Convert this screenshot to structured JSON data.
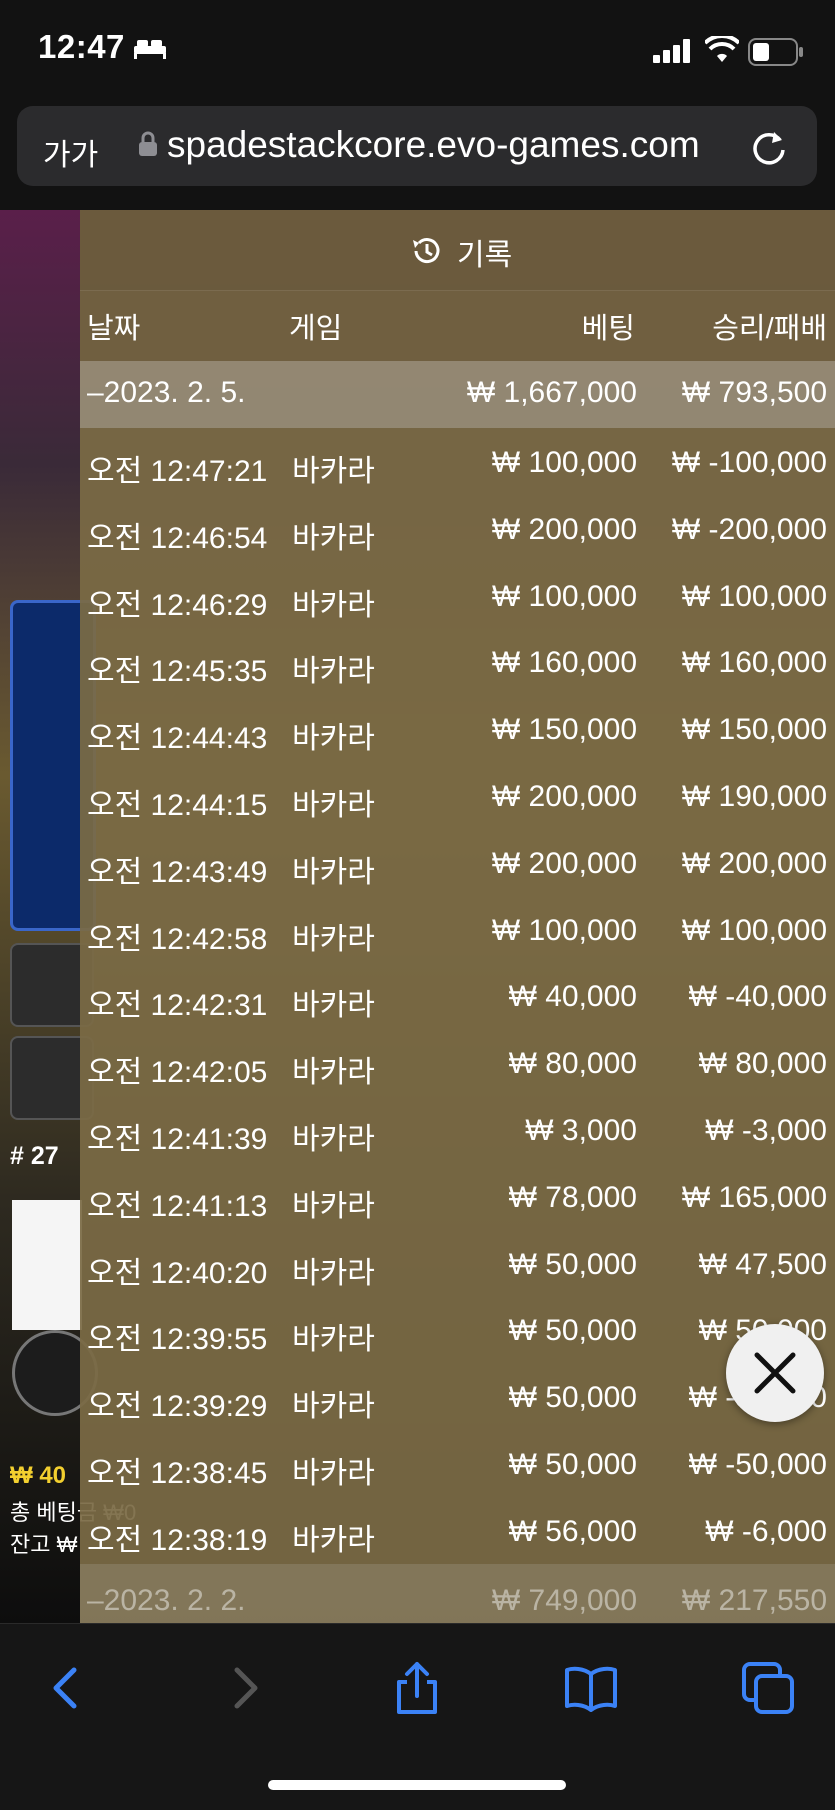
{
  "status_bar": {
    "time": "12:47",
    "icons": [
      "bed-icon",
      "cellular-signal-icon",
      "wifi-icon",
      "battery-icon"
    ]
  },
  "browser": {
    "aa_label": "가가",
    "url": "spadestackcore.evo-games.com",
    "icons": [
      "lock-icon",
      "reload-icon"
    ]
  },
  "game_background": {
    "round_label": "# 27",
    "bet_amount": "₩ 40",
    "total_bet": "총 베팅금 ₩0",
    "balance": "잔고 ₩"
  },
  "history": {
    "title": "기록",
    "columns": {
      "date": "날짜",
      "game": "게임",
      "bet": "베팅",
      "win_loss": "승리/패배"
    },
    "day_group": {
      "date": "–2023. 2. 5.",
      "bet": "₩ 1,667,000",
      "win_loss": "₩ 793,500"
    },
    "rows": [
      {
        "time": "오전 12:47:21",
        "game": "바카라",
        "bet": "₩ 100,000",
        "win_loss": "₩ -100,000"
      },
      {
        "time": "오전 12:46:54",
        "game": "바카라",
        "bet": "₩ 200,000",
        "win_loss": "₩ -200,000"
      },
      {
        "time": "오전 12:46:29",
        "game": "바카라",
        "bet": "₩ 100,000",
        "win_loss": "₩ 100,000"
      },
      {
        "time": "오전 12:45:35",
        "game": "바카라",
        "bet": "₩ 160,000",
        "win_loss": "₩ 160,000"
      },
      {
        "time": "오전 12:44:43",
        "game": "바카라",
        "bet": "₩ 150,000",
        "win_loss": "₩ 150,000"
      },
      {
        "time": "오전 12:44:15",
        "game": "바카라",
        "bet": "₩ 200,000",
        "win_loss": "₩ 190,000"
      },
      {
        "time": "오전 12:43:49",
        "game": "바카라",
        "bet": "₩ 200,000",
        "win_loss": "₩ 200,000"
      },
      {
        "time": "오전 12:42:58",
        "game": "바카라",
        "bet": "₩ 100,000",
        "win_loss": "₩ 100,000"
      },
      {
        "time": "오전 12:42:31",
        "game": "바카라",
        "bet": "₩ 40,000",
        "win_loss": "₩ -40,000"
      },
      {
        "time": "오전 12:42:05",
        "game": "바카라",
        "bet": "₩ 80,000",
        "win_loss": "₩ 80,000"
      },
      {
        "time": "오전 12:41:39",
        "game": "바카라",
        "bet": "₩ 3,000",
        "win_loss": "₩ -3,000"
      },
      {
        "time": "오전 12:41:13",
        "game": "바카라",
        "bet": "₩ 78,000",
        "win_loss": "₩ 165,000"
      },
      {
        "time": "오전 12:40:20",
        "game": "바카라",
        "bet": "₩ 50,000",
        "win_loss": "₩ 47,500"
      },
      {
        "time": "오전 12:39:55",
        "game": "바카라",
        "bet": "₩ 50,000",
        "win_loss": "₩ 50,000"
      },
      {
        "time": "오전 12:39:29",
        "game": "바카라",
        "bet": "₩ 50,000",
        "win_loss": "₩ -50,000"
      },
      {
        "time": "오전 12:38:45",
        "game": "바카라",
        "bet": "₩ 50,000",
        "win_loss": "₩ -50,000"
      },
      {
        "time": "오전 12:38:19",
        "game": "바카라",
        "bet": "₩ 56,000",
        "win_loss": "₩ -6,000"
      }
    ],
    "next_day_group": {
      "date": "–2023. 2. 2.",
      "bet": "₩ 749,000",
      "win_loss": "₩ 217,550"
    }
  },
  "toolbar": {
    "icons": [
      "back-icon",
      "forward-icon",
      "share-icon",
      "bookmarks-icon",
      "tabs-icon"
    ]
  },
  "colors": {
    "accent_blue": "#3b82f6",
    "panel_overlay": "#7b6a45",
    "highlight_yellow": "#f2cf2f"
  }
}
